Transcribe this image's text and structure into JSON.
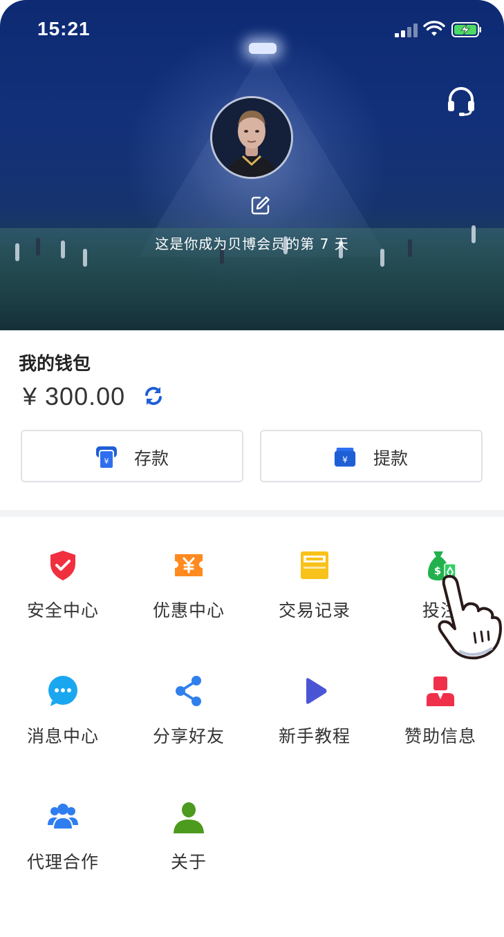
{
  "status_bar": {
    "time": "15:21"
  },
  "profile": {
    "member_days_text": "这是你成为贝博会员的第 7 天"
  },
  "wallet": {
    "title": "我的钱包",
    "balance": "¥  300.00",
    "deposit_label": "存款",
    "withdraw_label": "提款"
  },
  "menu": {
    "items": [
      {
        "label": "安全中心",
        "icon": "shield-icon",
        "color": "#f0303f"
      },
      {
        "label": "优惠中心",
        "icon": "ticket-icon",
        "color": "#ff8a1f"
      },
      {
        "label": "交易记录",
        "icon": "ledger-icon",
        "color": "#f8c21a"
      },
      {
        "label": "投注",
        "icon": "money-bag-icon",
        "color": "#22b14c"
      },
      {
        "label": "消息中心",
        "icon": "chat-bubble-icon",
        "color": "#1aa7f0"
      },
      {
        "label": "分享好友",
        "icon": "share-icon",
        "color": "#2f80ed"
      },
      {
        "label": "新手教程",
        "icon": "play-icon",
        "color": "#4a55d6"
      },
      {
        "label": "赞助信息",
        "icon": "sponsor-person-icon",
        "color": "#f0304a"
      },
      {
        "label": "代理合作",
        "icon": "team-icon",
        "color": "#2f7ef0"
      },
      {
        "label": "关于",
        "icon": "person-icon",
        "color": "#4c9a1e"
      }
    ]
  },
  "colors": {
    "hero_top": "#0d2a73",
    "accent_blue": "#1f5fd6",
    "divider": "#f2f3f5"
  }
}
